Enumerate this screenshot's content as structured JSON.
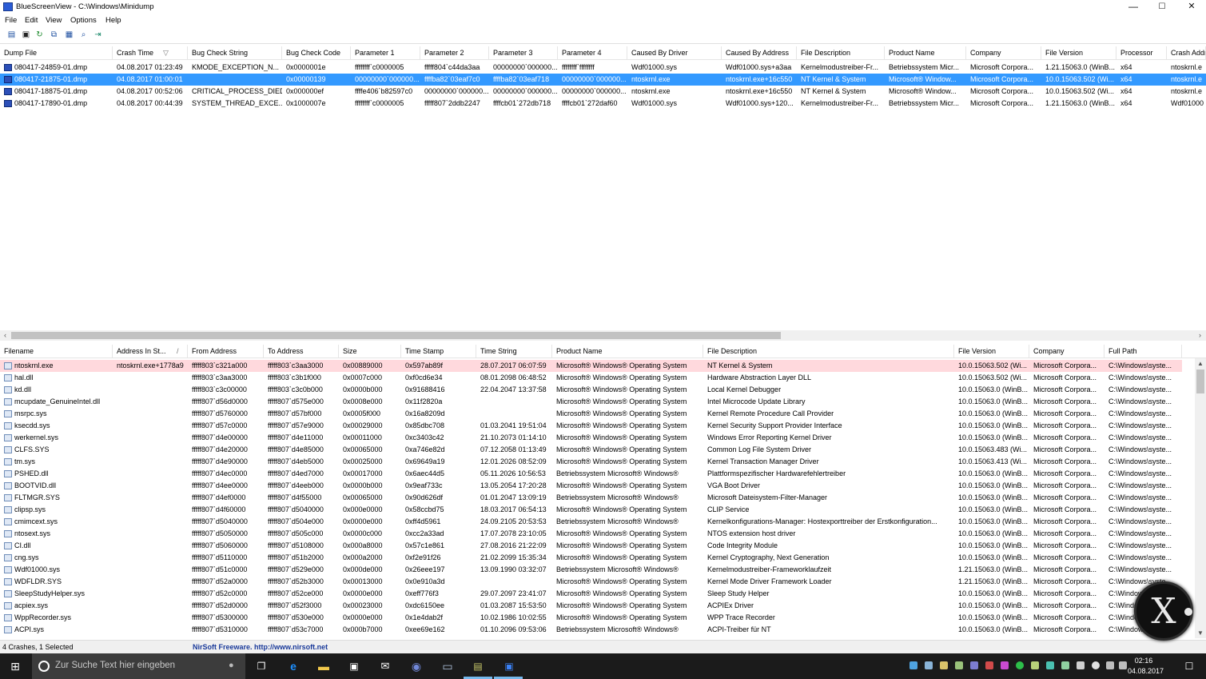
{
  "window": {
    "title": "BlueScreenView  -  C:\\Windows\\Minidump",
    "minimize": "—",
    "maximize": "☐",
    "close": "✕"
  },
  "menu": [
    "File",
    "Edit",
    "View",
    "Options",
    "Help"
  ],
  "toolbar_icons": [
    "properties-icon",
    "save-icon",
    "refresh-icon",
    "copy-icon",
    "html-report-icon",
    "find-icon",
    "exit-icon"
  ],
  "top_columns": [
    "Dump File",
    "Crash Time",
    "Bug Check String",
    "Bug Check Code",
    "Parameter 1",
    "Parameter 2",
    "Parameter 3",
    "Parameter 4",
    "Caused By Driver",
    "Caused By Address",
    "File Description",
    "Product Name",
    "Company",
    "File Version",
    "Processor",
    "Crash Addr"
  ],
  "sort_indicator": "▽",
  "crashes": [
    [
      "080417-24859-01.dmp",
      "04.08.2017 01:23:49",
      "KMODE_EXCEPTION_N...",
      "0x0000001e",
      "ffffffff`c0000005",
      "fffff804`c44da3aa",
      "00000000`000000...",
      "ffffffff`ffffffff",
      "Wdf01000.sys",
      "Wdf01000.sys+a3aa",
      "Kernelmodustreiber-Fr...",
      "Betriebssystem Micr...",
      "Microsoft Corpora...",
      "1.21.15063.0 (WinB...",
      "x64",
      "ntoskrnl.e"
    ],
    [
      "080417-21875-01.dmp",
      "04.08.2017 01:00:01",
      "",
      "0x00000139",
      "00000000`000000...",
      "ffffba82`03eaf7c0",
      "ffffba82`03eaf718",
      "00000000`000000...",
      "ntoskrnl.exe",
      "ntoskrnl.exe+16c550",
      "NT Kernel & System",
      "Microsoft® Window...",
      "Microsoft Corpora...",
      "10.0.15063.502 (Wi...",
      "x64",
      "ntoskrnl.e"
    ],
    [
      "080417-18875-01.dmp",
      "04.08.2017 00:52:06",
      "CRITICAL_PROCESS_DIED",
      "0x000000ef",
      "ffffe406`b82597c0",
      "00000000`000000...",
      "00000000`000000...",
      "00000000`000000...",
      "ntoskrnl.exe",
      "ntoskrnl.exe+16c550",
      "NT Kernel & System",
      "Microsoft® Window...",
      "Microsoft Corpora...",
      "10.0.15063.502 (Wi...",
      "x64",
      "ntoskrnl.e"
    ],
    [
      "080417-17890-01.dmp",
      "04.08.2017 00:44:39",
      "SYSTEM_THREAD_EXCE...",
      "0x1000007e",
      "ffffffff`c0000005",
      "fffff807`2ddb2247",
      "ffffcb01`272db718",
      "ffffcb01`272daf60",
      "Wdf01000.sys",
      "Wdf01000.sys+120...",
      "Kernelmodustreiber-Fr...",
      "Betriebssystem Micr...",
      "Microsoft Corpora...",
      "1.21.15063.0 (WinB...",
      "x64",
      "Wdf01000"
    ]
  ],
  "bottom_columns": [
    "Filename",
    "Address In St...",
    "From Address",
    "To Address",
    "Size",
    "Time Stamp",
    "Time String",
    "Product Name",
    "File Description",
    "File Version",
    "Company",
    "Full Path"
  ],
  "bottom_sort_indicator": "/",
  "drivers": [
    [
      "ntoskrnl.exe",
      "ntoskrnl.exe+1778a9",
      "fffff803`c321a000",
      "fffff803`c3aa3000",
      "0x00889000",
      "0x597ab89f",
      "28.07.2017 06:07:59",
      "Microsoft® Windows® Operating System",
      "NT Kernel & System",
      "10.0.15063.502 (Wi...",
      "Microsoft Corpora...",
      "C:\\Windows\\syste..."
    ],
    [
      "hal.dll",
      "",
      "fffff803`c3aa3000",
      "fffff803`c3b1f000",
      "0x0007c000",
      "0xf0cd6e34",
      "08.01.2098 06:48:52",
      "Microsoft® Windows® Operating System",
      "Hardware Abstraction Layer DLL",
      "10.0.15063.502 (Wi...",
      "Microsoft Corpora...",
      "C:\\Windows\\syste..."
    ],
    [
      "kd.dll",
      "",
      "fffff803`c3c00000",
      "fffff803`c3c0b000",
      "0x0000b000",
      "0x91688416",
      "22.04.2047 13:37:58",
      "Microsoft® Windows® Operating System",
      "Local Kernel Debugger",
      "10.0.15063.0 (WinB...",
      "Microsoft Corpora...",
      "C:\\Windows\\syste..."
    ],
    [
      "mcupdate_GenuineIntel.dll",
      "",
      "fffff807`d56d0000",
      "fffff807`d575e000",
      "0x0008e000",
      "0x11f2820a",
      "",
      "Microsoft® Windows® Operating System",
      "Intel Microcode Update Library",
      "10.0.15063.0 (WinB...",
      "Microsoft Corpora...",
      "C:\\Windows\\syste..."
    ],
    [
      "msrpc.sys",
      "",
      "fffff807`d5760000",
      "fffff807`d57bf000",
      "0x0005f000",
      "0x16a8209d",
      "",
      "Microsoft® Windows® Operating System",
      "Kernel Remote Procedure Call Provider",
      "10.0.15063.0 (WinB...",
      "Microsoft Corpora...",
      "C:\\Windows\\syste..."
    ],
    [
      "ksecdd.sys",
      "",
      "fffff807`d57c0000",
      "fffff807`d57e9000",
      "0x00029000",
      "0x85dbc708",
      "01.03.2041 19:51:04",
      "Microsoft® Windows® Operating System",
      "Kernel Security Support Provider Interface",
      "10.0.15063.0 (WinB...",
      "Microsoft Corpora...",
      "C:\\Windows\\syste..."
    ],
    [
      "werkernel.sys",
      "",
      "fffff807`d4e00000",
      "fffff807`d4e11000",
      "0x00011000",
      "0xc3403c42",
      "21.10.2073 01:14:10",
      "Microsoft® Windows® Operating System",
      "Windows Error Reporting Kernel Driver",
      "10.0.15063.0 (WinB...",
      "Microsoft Corpora...",
      "C:\\Windows\\syste..."
    ],
    [
      "CLFS.SYS",
      "",
      "fffff807`d4e20000",
      "fffff807`d4e85000",
      "0x00065000",
      "0xa746e82d",
      "07.12.2058 01:13:49",
      "Microsoft® Windows® Operating System",
      "Common Log File System Driver",
      "10.0.15063.483 (Wi...",
      "Microsoft Corpora...",
      "C:\\Windows\\syste..."
    ],
    [
      "tm.sys",
      "",
      "fffff807`d4e90000",
      "fffff807`d4eb5000",
      "0x00025000",
      "0x69649a19",
      "12.01.2026 08:52:09",
      "Microsoft® Windows® Operating System",
      "Kernel Transaction Manager Driver",
      "10.0.15063.413 (Wi...",
      "Microsoft Corpora...",
      "C:\\Windows\\syste..."
    ],
    [
      "PSHED.dll",
      "",
      "fffff807`d4ec0000",
      "fffff807`d4ed7000",
      "0x00017000",
      "0x6aec44d5",
      "05.11.2026 10:56:53",
      "Betriebssystem Microsoft® Windows®",
      "Plattformspezifischer Hardwarefehlertreiber",
      "10.0.15063.0 (WinB...",
      "Microsoft Corpora...",
      "C:\\Windows\\syste..."
    ],
    [
      "BOOTVID.dll",
      "",
      "fffff807`d4ee0000",
      "fffff807`d4eeb000",
      "0x0000b000",
      "0x9eaf733c",
      "13.05.2054 17:20:28",
      "Microsoft® Windows® Operating System",
      "VGA Boot Driver",
      "10.0.15063.0 (WinB...",
      "Microsoft Corpora...",
      "C:\\Windows\\syste..."
    ],
    [
      "FLTMGR.SYS",
      "",
      "fffff807`d4ef0000",
      "fffff807`d4f55000",
      "0x00065000",
      "0x90d626df",
      "01.01.2047 13:09:19",
      "Betriebssystem Microsoft® Windows®",
      "Microsoft Dateisystem-Filter-Manager",
      "10.0.15063.0 (WinB...",
      "Microsoft Corpora...",
      "C:\\Windows\\syste..."
    ],
    [
      "clipsp.sys",
      "",
      "fffff807`d4f60000",
      "fffff807`d5040000",
      "0x000e0000",
      "0x58ccbd75",
      "18.03.2017 06:54:13",
      "Microsoft® Windows® Operating System",
      "CLIP Service",
      "10.0.15063.0 (WinB...",
      "Microsoft Corpora...",
      "C:\\Windows\\syste..."
    ],
    [
      "cmimcext.sys",
      "",
      "fffff807`d5040000",
      "fffff807`d504e000",
      "0x0000e000",
      "0xff4d5961",
      "24.09.2105 20:53:53",
      "Betriebssystem Microsoft® Windows®",
      "Kernelkonfigurations-Manager: Hostexporttreiber der Erstkonfiguration...",
      "10.0.15063.0 (WinB...",
      "Microsoft Corpora...",
      "C:\\Windows\\syste..."
    ],
    [
      "ntosext.sys",
      "",
      "fffff807`d5050000",
      "fffff807`d505c000",
      "0x0000c000",
      "0xcc2a33ad",
      "17.07.2078 23:10:05",
      "Microsoft® Windows® Operating System",
      "NTOS extension host driver",
      "10.0.15063.0 (WinB...",
      "Microsoft Corpora...",
      "C:\\Windows\\syste..."
    ],
    [
      "CI.dll",
      "",
      "fffff807`d5060000",
      "fffff807`d5108000",
      "0x000a8000",
      "0x57c1e861",
      "27.08.2016 21:22:09",
      "Microsoft® Windows® Operating System",
      "Code Integrity Module",
      "10.0.15063.0 (WinB...",
      "Microsoft Corpora...",
      "C:\\Windows\\syste..."
    ],
    [
      "cng.sys",
      "",
      "fffff807`d5110000",
      "fffff807`d51b2000",
      "0x000a2000",
      "0xf2e91f26",
      "21.02.2099 15:35:34",
      "Microsoft® Windows® Operating System",
      "Kernel Cryptography, Next Generation",
      "10.0.15063.0 (WinB...",
      "Microsoft Corpora...",
      "C:\\Windows\\syste..."
    ],
    [
      "Wdf01000.sys",
      "",
      "fffff807`d51c0000",
      "fffff807`d529e000",
      "0x000de000",
      "0x26eee197",
      "13.09.1990 03:32:07",
      "Betriebssystem Microsoft® Windows®",
      "Kernelmodustreiber-Frameworklaufzeit",
      "1.21.15063.0 (WinB...",
      "Microsoft Corpora...",
      "C:\\Windows\\syste..."
    ],
    [
      "WDFLDR.SYS",
      "",
      "fffff807`d52a0000",
      "fffff807`d52b3000",
      "0x00013000",
      "0x0e910a3d",
      "",
      "Microsoft® Windows® Operating System",
      "Kernel Mode Driver Framework Loader",
      "1.21.15063.0 (WinB...",
      "Microsoft Corpora...",
      "C:\\Windows\\syste..."
    ],
    [
      "SleepStudyHelper.sys",
      "",
      "fffff807`d52c0000",
      "fffff807`d52ce000",
      "0x0000e000",
      "0xeff776f3",
      "29.07.2097 23:41:07",
      "Microsoft® Windows® Operating System",
      "Sleep Study Helper",
      "10.0.15063.0 (WinB...",
      "Microsoft Corpora...",
      "C:\\Windows\\syste..."
    ],
    [
      "acpiex.sys",
      "",
      "fffff807`d52d0000",
      "fffff807`d52f3000",
      "0x00023000",
      "0xdc6150ee",
      "01.03.2087 15:53:50",
      "Microsoft® Windows® Operating System",
      "ACPIEx Driver",
      "10.0.15063.0 (WinB...",
      "Microsoft Corpora...",
      "C:\\Windows\\syste..."
    ],
    [
      "WppRecorder.sys",
      "",
      "fffff807`d5300000",
      "fffff807`d530e000",
      "0x0000e000",
      "0x1e4dab2f",
      "10.02.1986 10:02:55",
      "Microsoft® Windows® Operating System",
      "WPP Trace Recorder",
      "10.0.15063.0 (WinB...",
      "Microsoft Corpora...",
      "C:\\Windows\\syste..."
    ],
    [
      "ACPI.sys",
      "",
      "fffff807`d5310000",
      "fffff807`d53c7000",
      "0x000b7000",
      "0xee69e162",
      "01.10.2096 09:53:06",
      "Betriebssystem Microsoft® Windows®",
      "ACPI-Treiber für NT",
      "10.0.15063.0 (WinB...",
      "Microsoft Corpora...",
      "C:\\Windows\\syste..."
    ]
  ],
  "status": {
    "summary": "4 Crashes, 1 Selected",
    "credit": "NirSoft Freeware.  http://www.nirsoft.net"
  },
  "taskbar": {
    "search_placeholder": "Zur Suche Text hier eingeben",
    "time": "02:16",
    "date": "04.08.2017",
    "pinned_icons": [
      "task-view-icon",
      "edge-icon",
      "explorer-icon",
      "store-icon",
      "mail-icon",
      "discord-icon",
      "network-app-icon",
      "terminal-icon",
      "bluescreenview-icon"
    ]
  },
  "colors": {
    "selected_row": "#3399ff",
    "highlight_row": "#ffd9dd",
    "taskbar": "#1b1b1b"
  }
}
